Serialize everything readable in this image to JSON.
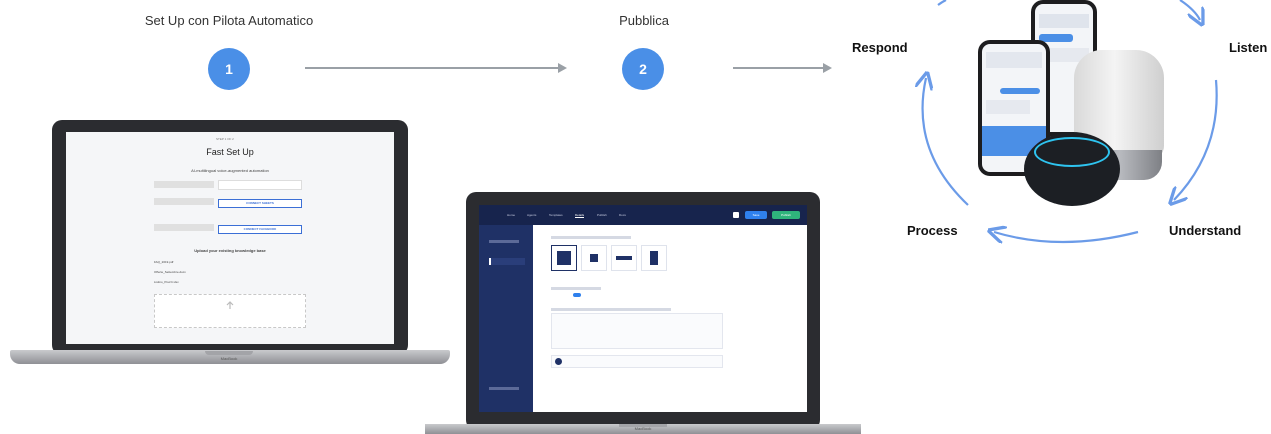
{
  "steps": [
    {
      "label": "Set Up con Pilota Automatico",
      "number": "1"
    },
    {
      "label": "Pubblica",
      "number": "2"
    }
  ],
  "cycle": {
    "labels": {
      "respond": "Respond",
      "listen": "Listen",
      "process": "Process",
      "understand": "Understand"
    },
    "arc_color": "#6b9be8"
  },
  "laptop1": {
    "brand": "MacBook",
    "screen": {
      "step_indicator": "STEP 1 OF 2",
      "title": "Fast Set Up",
      "subtitle": "AI-multilingual voice-augmented automation",
      "upload_heading": "Upload your existing knowledge base",
      "connect_sheets_label": "CONNECT SHEETS",
      "connect_facebook_label": "CONNECT FACEBOOK",
      "files": [
        "FAQ_2019.pdf",
        "Offerte_Settembre.docx",
        "Listino_Prezzi.xlsx"
      ]
    }
  },
  "laptop2": {
    "brand": "MacBook",
    "screen": {
      "nav_items": [
        "Home",
        "Agents",
        "Templates",
        "Details",
        "Publish",
        "Docs"
      ],
      "active_nav_index": 3,
      "save_label": "Save",
      "publish_label": "Publish"
    }
  },
  "colors": {
    "accent_blue": "#4a8fe7",
    "arrow_gray": "#9aa0a6",
    "dashboard_navy": "#1f3166"
  }
}
